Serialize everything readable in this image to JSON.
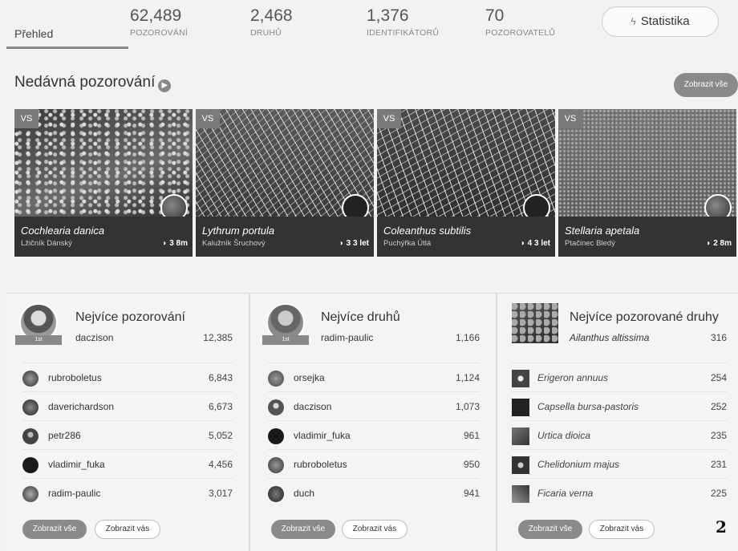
{
  "header": {
    "tab_overview": "Přehled",
    "stats": [
      {
        "value": "62,489",
        "label": "POZOROVÁNÍ"
      },
      {
        "value": "2,468",
        "label": "DRUHŮ"
      },
      {
        "value": "1,376",
        "label": "IDENTIFIKÁTORŮ"
      },
      {
        "value": "70",
        "label": "POZOROVATELŮ"
      }
    ],
    "stats_button": "Statistika"
  },
  "recent": {
    "title": "Nedávná pozorování",
    "show_all": "Zobrazit vše",
    "items": [
      {
        "badge": "VS",
        "latin": "Cochlearia danica",
        "common": "Lžičník Dánský",
        "meta": "3 8m"
      },
      {
        "badge": "VS",
        "latin": "Lythrum portula",
        "common": "Kalužník Šruchový",
        "meta": "3 3 let"
      },
      {
        "badge": "VS",
        "latin": "Coleanthus subtilis",
        "common": "Puchýřka Útlá",
        "meta": "4 3 let"
      },
      {
        "badge": "VS",
        "latin": "Stellaria apetala",
        "common": "Ptačinec Bledý",
        "meta": "2 8m"
      }
    ]
  },
  "most_observations": {
    "title": "Nejvíce pozorování",
    "ribbon": "1st",
    "leader": {
      "name": "daczison",
      "value": "12,385"
    },
    "rows": [
      {
        "name": "rubroboletus",
        "value": "6,843"
      },
      {
        "name": "daverichardson",
        "value": "6,673"
      },
      {
        "name": "petr286",
        "value": "5,052"
      },
      {
        "name": "vladimir_fuka",
        "value": "4,456"
      },
      {
        "name": "radim-paulic",
        "value": "3,017"
      }
    ],
    "show_all": "Zobrazit vše",
    "show_you": "Zobrazit vás"
  },
  "most_species": {
    "title": "Nejvíce druhů",
    "ribbon": "1st",
    "leader": {
      "name": "radim-paulic",
      "value": "1,166"
    },
    "rows": [
      {
        "name": "orsejka",
        "value": "1,124"
      },
      {
        "name": "daczison",
        "value": "1,073"
      },
      {
        "name": "vladimir_fuka",
        "value": "961"
      },
      {
        "name": "rubroboletus",
        "value": "950"
      },
      {
        "name": "duch",
        "value": "941"
      }
    ],
    "show_all": "Zobrazit vše",
    "show_you": "Zobrazit vás"
  },
  "most_observed_species": {
    "title": "Nejvíce pozorované druhy",
    "leader": {
      "name": "Ailanthus altissima",
      "value": "316"
    },
    "rows": [
      {
        "name": "Erigeron annuus",
        "value": "254"
      },
      {
        "name": "Capsella bursa-pastoris",
        "value": "252"
      },
      {
        "name": "Urtica dioica",
        "value": "235"
      },
      {
        "name": "Chelidonium majus",
        "value": "231"
      },
      {
        "name": "Ficaria verna",
        "value": "225"
      }
    ],
    "show_all": "Zobrazit vše",
    "show_you": "Zobrazit vás"
  },
  "page_number": "2"
}
